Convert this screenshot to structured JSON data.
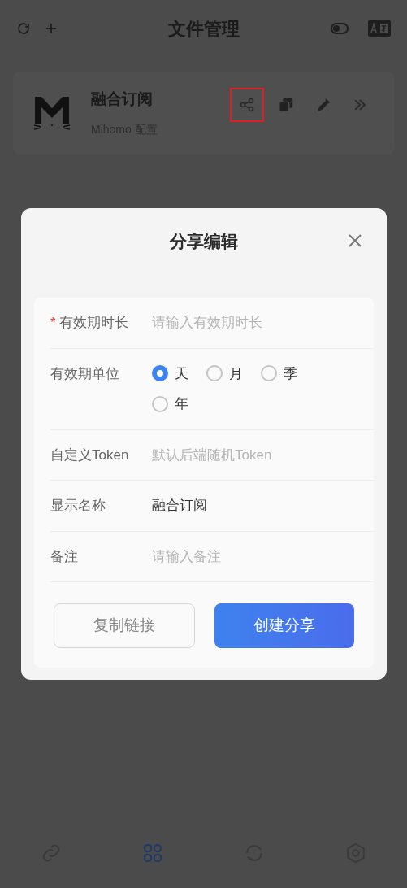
{
  "header": {
    "title": "文件管理"
  },
  "card": {
    "title": "融合订阅",
    "subtitle": "Mihomo 配置",
    "share_highlighted": true
  },
  "dialog": {
    "title": "分享编辑",
    "fields": [
      {
        "kind": "input",
        "label": "有效期时长",
        "required_mark": "*",
        "placeholder": "请输入有效期时长"
      },
      {
        "kind": "radio",
        "label": "有效期单位",
        "options": [
          {
            "label": "天",
            "selected": true
          },
          {
            "label": "月",
            "selected": false
          },
          {
            "label": "季",
            "selected": false
          },
          {
            "label": "年",
            "selected": false
          }
        ]
      },
      {
        "kind": "input",
        "label": "自定义Token",
        "placeholder": "默认后端随机Token"
      },
      {
        "kind": "input",
        "label": "显示名称",
        "value": "融合订阅"
      },
      {
        "kind": "input",
        "label": "备注",
        "placeholder": "请输入备注"
      }
    ],
    "buttons": [
      {
        "label": "复制链接",
        "kind": "secondary"
      },
      {
        "label": "创建分享",
        "kind": "primary"
      }
    ]
  },
  "nav": [
    {
      "selected": false
    },
    {
      "selected": true
    },
    {
      "selected": false
    },
    {
      "selected": false
    }
  ]
}
